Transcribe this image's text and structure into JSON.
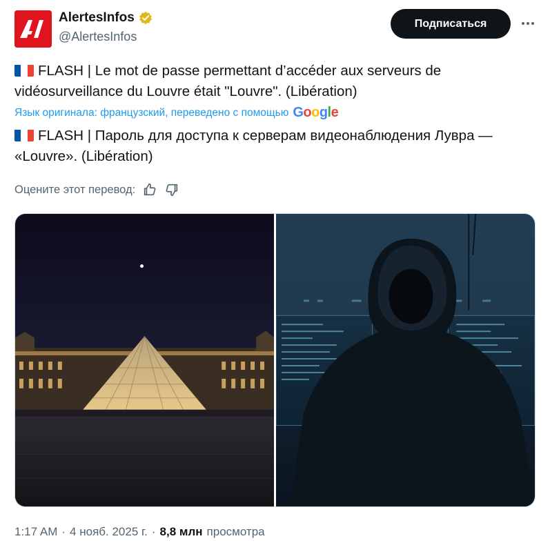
{
  "author": {
    "display_name": "AlertesInfos",
    "handle": "@AlertesInfos",
    "avatar_text": "AI",
    "verified": true
  },
  "actions": {
    "subscribe_label": "Подписаться",
    "more_icon": "more-horizontal-icon"
  },
  "tweet": {
    "original_text": "FLASH | Le mot de passe permettant d’accéder aux serveurs de vidéosurveillance du Louvre était \"Louvre\". (Libération)",
    "translation_note": "Язык оригинала: французский, переведено с помощью",
    "translation_provider": "Google",
    "translated_text": "FLASH | Пароль для доступа к серверам видеонаблюдения Лувра — «Louvre». (Libération)",
    "rate_prompt": "Оцените этот перевод:"
  },
  "meta": {
    "time": "1:17 AM",
    "date": "4 нояб. 2025 г.",
    "separator": "·",
    "views_count": "8,8 млн",
    "views_label": "просмотра"
  },
  "colors": {
    "accent": "#1d9bf0",
    "text_primary": "#0f1419",
    "text_secondary": "#536471",
    "avatar_bg": "#e0141e",
    "verified_badge": "#e2b719"
  }
}
